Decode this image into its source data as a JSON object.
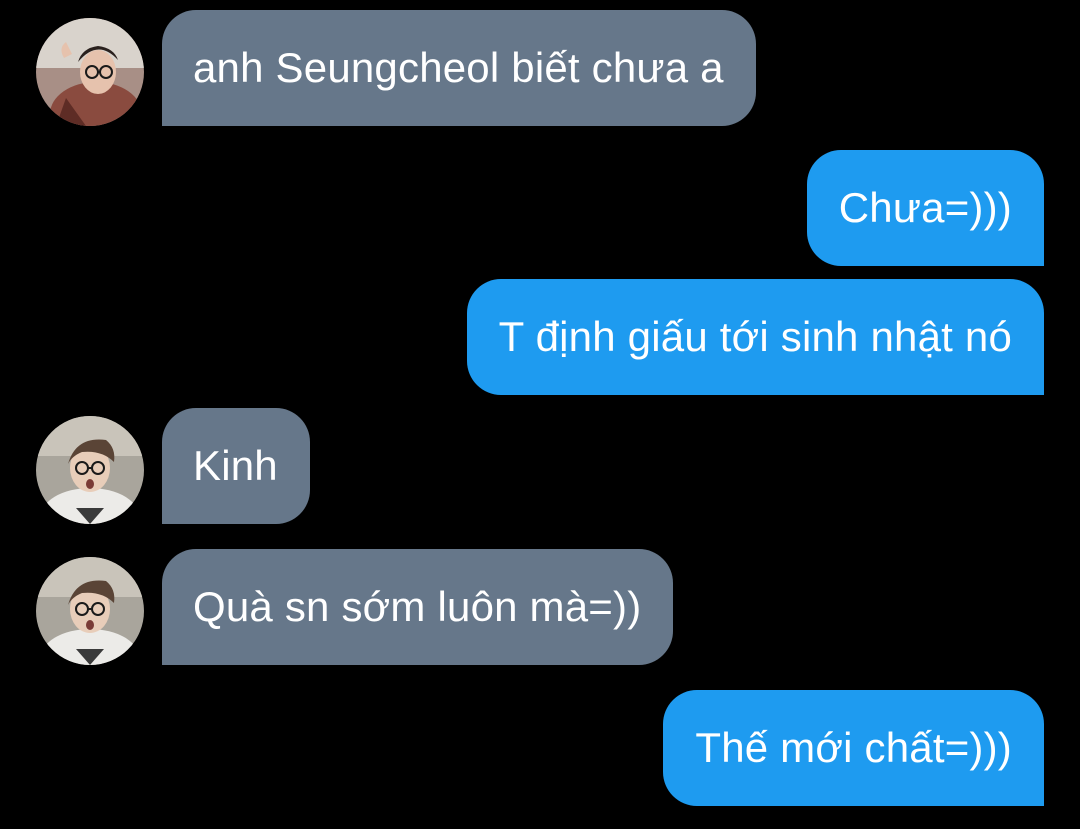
{
  "conversation": {
    "messages": [
      {
        "sender": "other",
        "avatar": "avatar-icon",
        "text": "anh Seungcheol biết chưa a"
      },
      {
        "sender": "me",
        "text": "Chưa=)))"
      },
      {
        "sender": "me",
        "text": "T định giấu tới sinh nhật nó"
      },
      {
        "sender": "other",
        "avatar": "avatar-icon",
        "text": "Kinh"
      },
      {
        "sender": "other",
        "avatar": "avatar-icon",
        "text": "Quà sn sớm luôn mà=))"
      },
      {
        "sender": "me",
        "text": "Thế mới chất=)))"
      }
    ]
  },
  "colors": {
    "background": "#000000",
    "received_bubble": "#66778a",
    "sent_bubble": "#1e9bf0",
    "text": "#ffffff"
  }
}
